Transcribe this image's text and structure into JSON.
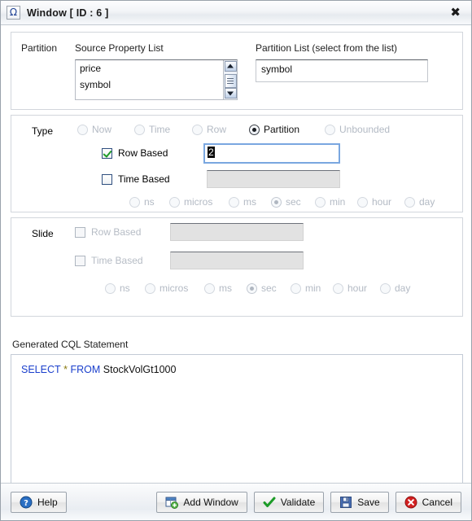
{
  "window": {
    "title": "Window [ ID : 6 ]",
    "icon": "omega-icon",
    "close_label": "✖"
  },
  "partition": {
    "section_label": "Partition",
    "source_list_label": "Source Property List",
    "source_items": [
      "price",
      "symbol"
    ],
    "partition_list_label": "Partition List (select from the list)",
    "partition_items": [
      "symbol"
    ]
  },
  "type": {
    "section_label": "Type",
    "options": [
      {
        "label": "Now",
        "selected": false,
        "enabled": false
      },
      {
        "label": "Time",
        "selected": false,
        "enabled": false
      },
      {
        "label": "Row",
        "selected": false,
        "enabled": false
      },
      {
        "label": "Partition",
        "selected": true,
        "enabled": true
      },
      {
        "label": "Unbounded",
        "selected": false,
        "enabled": false
      }
    ],
    "row_based": {
      "label": "Row Based",
      "checked": true,
      "enabled": true,
      "value": "2"
    },
    "time_based": {
      "label": "Time Based",
      "checked": false,
      "enabled": true,
      "value": ""
    },
    "units": [
      {
        "label": "ns",
        "selected": false
      },
      {
        "label": "micros",
        "selected": false
      },
      {
        "label": "ms",
        "selected": false
      },
      {
        "label": "sec",
        "selected": true
      },
      {
        "label": "min",
        "selected": false
      },
      {
        "label": "hour",
        "selected": false
      },
      {
        "label": "day",
        "selected": false
      }
    ]
  },
  "slide": {
    "section_label": "Slide",
    "row_based": {
      "label": "Row Based",
      "checked": false,
      "enabled": false,
      "value": ""
    },
    "time_based": {
      "label": "Time Based",
      "checked": false,
      "enabled": false,
      "value": ""
    },
    "units": [
      {
        "label": "ns",
        "selected": false
      },
      {
        "label": "micros",
        "selected": false
      },
      {
        "label": "ms",
        "selected": false
      },
      {
        "label": "sec",
        "selected": true
      },
      {
        "label": "min",
        "selected": false
      },
      {
        "label": "hour",
        "selected": false
      },
      {
        "label": "day",
        "selected": false
      }
    ]
  },
  "cql": {
    "label": "Generated CQL Statement",
    "keyword_select": "SELECT",
    "star": "*",
    "keyword_from": "FROM",
    "source": "StockVolGt1000"
  },
  "footer": {
    "help": "Help",
    "add_window": "Add Window",
    "validate": "Validate",
    "save": "Save",
    "cancel": "Cancel"
  },
  "colors": {
    "keyword": "#1a3fcc",
    "star": "#8a7a10",
    "check": "#1d9b28",
    "cancel": "#cc2020",
    "help": "#2a6fc4",
    "accent": "#7aa7e0"
  }
}
